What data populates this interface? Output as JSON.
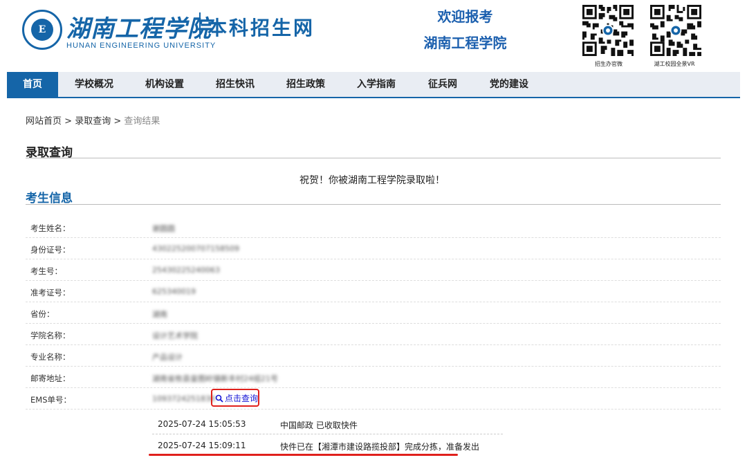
{
  "header": {
    "logo_cn": "湖南工程学院",
    "logo_en": "HUNAN ENGINEERING UNIVERSITY",
    "logo_sub": "本科招生网",
    "welcome_line1": "欢迎报考",
    "welcome_line2": "湖南工程学院",
    "qr1_caption": "招生办官微",
    "qr2_caption": "湖工校园全景VR"
  },
  "nav": {
    "items": [
      {
        "label": "首页",
        "active": true
      },
      {
        "label": "学校概况"
      },
      {
        "label": "机构设置"
      },
      {
        "label": "招生快讯"
      },
      {
        "label": "招生政策"
      },
      {
        "label": "入学指南"
      },
      {
        "label": "征兵网"
      },
      {
        "label": "党的建设"
      }
    ]
  },
  "breadcrumb": {
    "home": "网站首页",
    "sep": ">",
    "section": "录取查询",
    "current": "查询结果"
  },
  "page_title": "录取查询",
  "congrats": "祝贺！你被湖南工程学院录取啦！",
  "info_title": "考生信息",
  "info_rows": [
    {
      "label": "考生姓名：",
      "value": "谢圆圆"
    },
    {
      "label": "身份证号：",
      "value": "430225200707158509"
    },
    {
      "label": "考生号：",
      "value": "25430225240063"
    },
    {
      "label": "准考证号：",
      "value": "625340019"
    },
    {
      "label": "省份：",
      "value": "湖南"
    },
    {
      "label": "学院名称：",
      "value": "设计艺术学院"
    },
    {
      "label": "专业名称：",
      "value": "产品设计"
    },
    {
      "label": "邮寄地址：",
      "value": "湖南省攸县皇图岭镇新丰村24组21号"
    },
    {
      "label": "EMS单号：",
      "value": "1093724251838"
    }
  ],
  "ems_query_label": "点击查询",
  "tracking": [
    {
      "time": "2025-07-24 15:05:53",
      "desc": "中国邮政 已收取快件"
    },
    {
      "time": "2025-07-24 15:09:11",
      "desc": "快件已在【湘潭市建设路揽投部】完成分拣，准备发出"
    }
  ],
  "colors": {
    "brand": "#1565a8",
    "highlight": "#e0201c",
    "link": "#1515d6"
  }
}
